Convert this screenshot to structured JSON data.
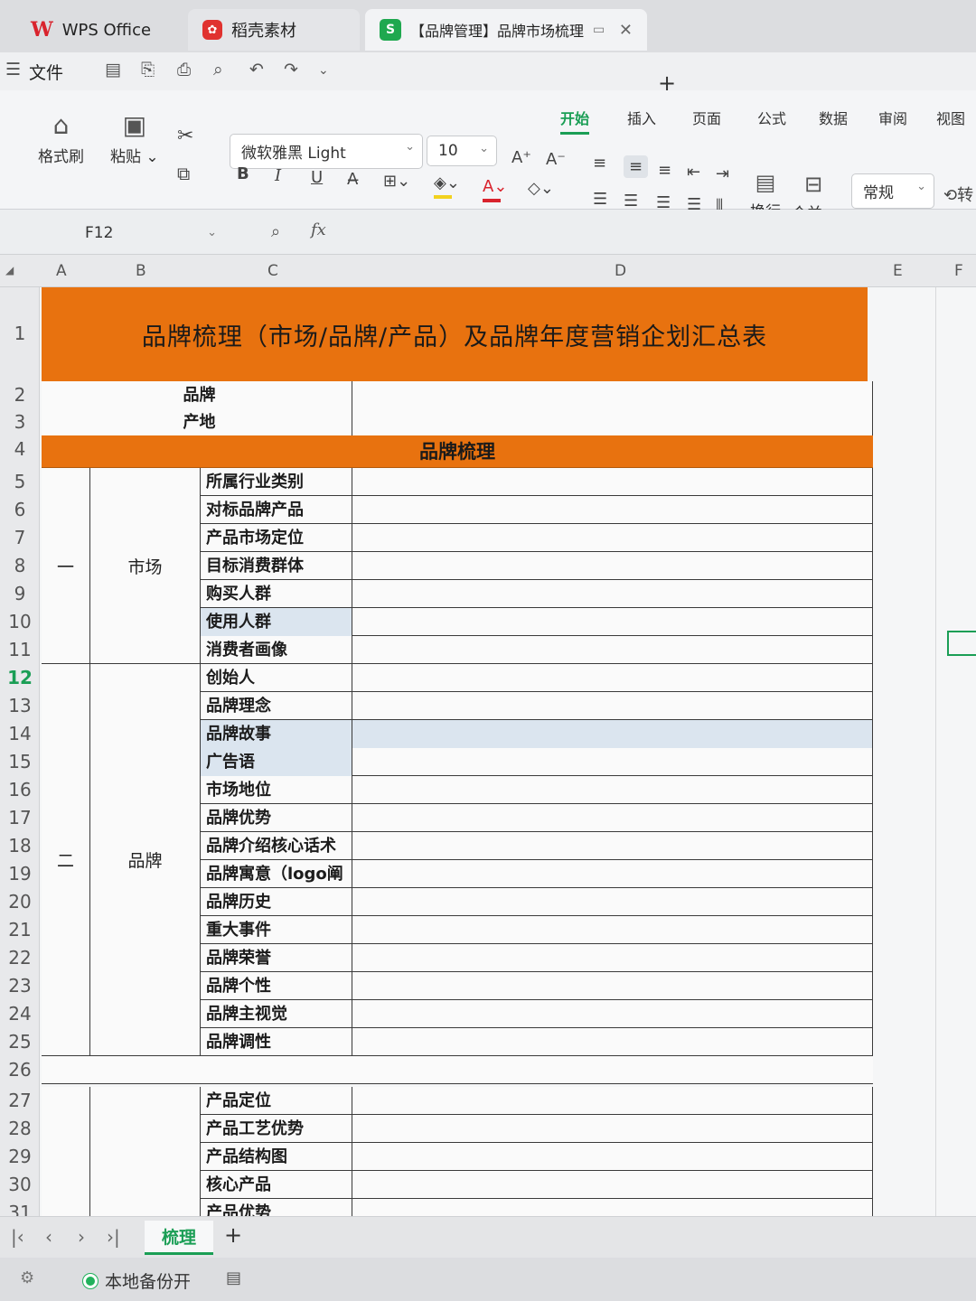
{
  "tabs": {
    "wps": "WPS Office",
    "daoke": "稻壳素材",
    "doc": "【品牌管理】品牌市场梳理",
    "doc_icon": "S",
    "new_tab": "+"
  },
  "quick": {
    "file_menu": "文件"
  },
  "ribbon": {
    "tabs": [
      "开始",
      "插入",
      "页面",
      "公式",
      "数据",
      "审阅",
      "视图"
    ],
    "format_painter": "格式刷",
    "paste": "粘贴",
    "font_name": "微软雅黑 Light",
    "font_size": "10",
    "bold": "B",
    "italic": "I",
    "underline": "U",
    "wrap": "换行",
    "merge": "合并",
    "number_format": "常规",
    "percent": "%",
    "transfer": "转",
    "accent": "#1a9e55",
    "orange": "#e8720f"
  },
  "formula_bar": {
    "cell_ref": "F12",
    "fx": "fx"
  },
  "columns": [
    "A",
    "B",
    "C",
    "D",
    "E",
    "F"
  ],
  "rows": [
    "1",
    "2",
    "3",
    "4",
    "5",
    "6",
    "7",
    "8",
    "9",
    "10",
    "11",
    "12",
    "13",
    "14",
    "15",
    "16",
    "17",
    "18",
    "19",
    "20",
    "21",
    "22",
    "23",
    "24",
    "25",
    "26",
    "27",
    "28",
    "29",
    "30",
    "31"
  ],
  "sheet": {
    "title": "品牌梳理（市场/品牌/产品）及品牌年度营销企划汇总表",
    "brand_label": "品牌",
    "origin_label": "产地",
    "section_header": "品牌梳理",
    "group1_no": "一",
    "group1_name": "市场",
    "group1_items": [
      "所属行业类别",
      "对标品牌产品",
      "产品市场定位",
      "目标消费群体",
      "购买人群",
      "使用人群",
      "消费者画像"
    ],
    "group2_no": "二",
    "group2_name": "品牌",
    "group2_items": [
      "创始人",
      "品牌理念",
      "品牌故事",
      "广告语",
      "市场地位",
      "品牌优势",
      "品牌介绍核心话术",
      "品牌寓意（logo阐释",
      "品牌历史",
      "重大事件",
      "品牌荣誉",
      "品牌个性",
      "品牌主视觉",
      "品牌调性"
    ],
    "group3_items": [
      "产品定位",
      "产品工艺优势",
      "产品结构图",
      "核心产品",
      "产品优势"
    ]
  },
  "sheet_tab": "梳理",
  "status": {
    "backup": "本地备份开"
  }
}
